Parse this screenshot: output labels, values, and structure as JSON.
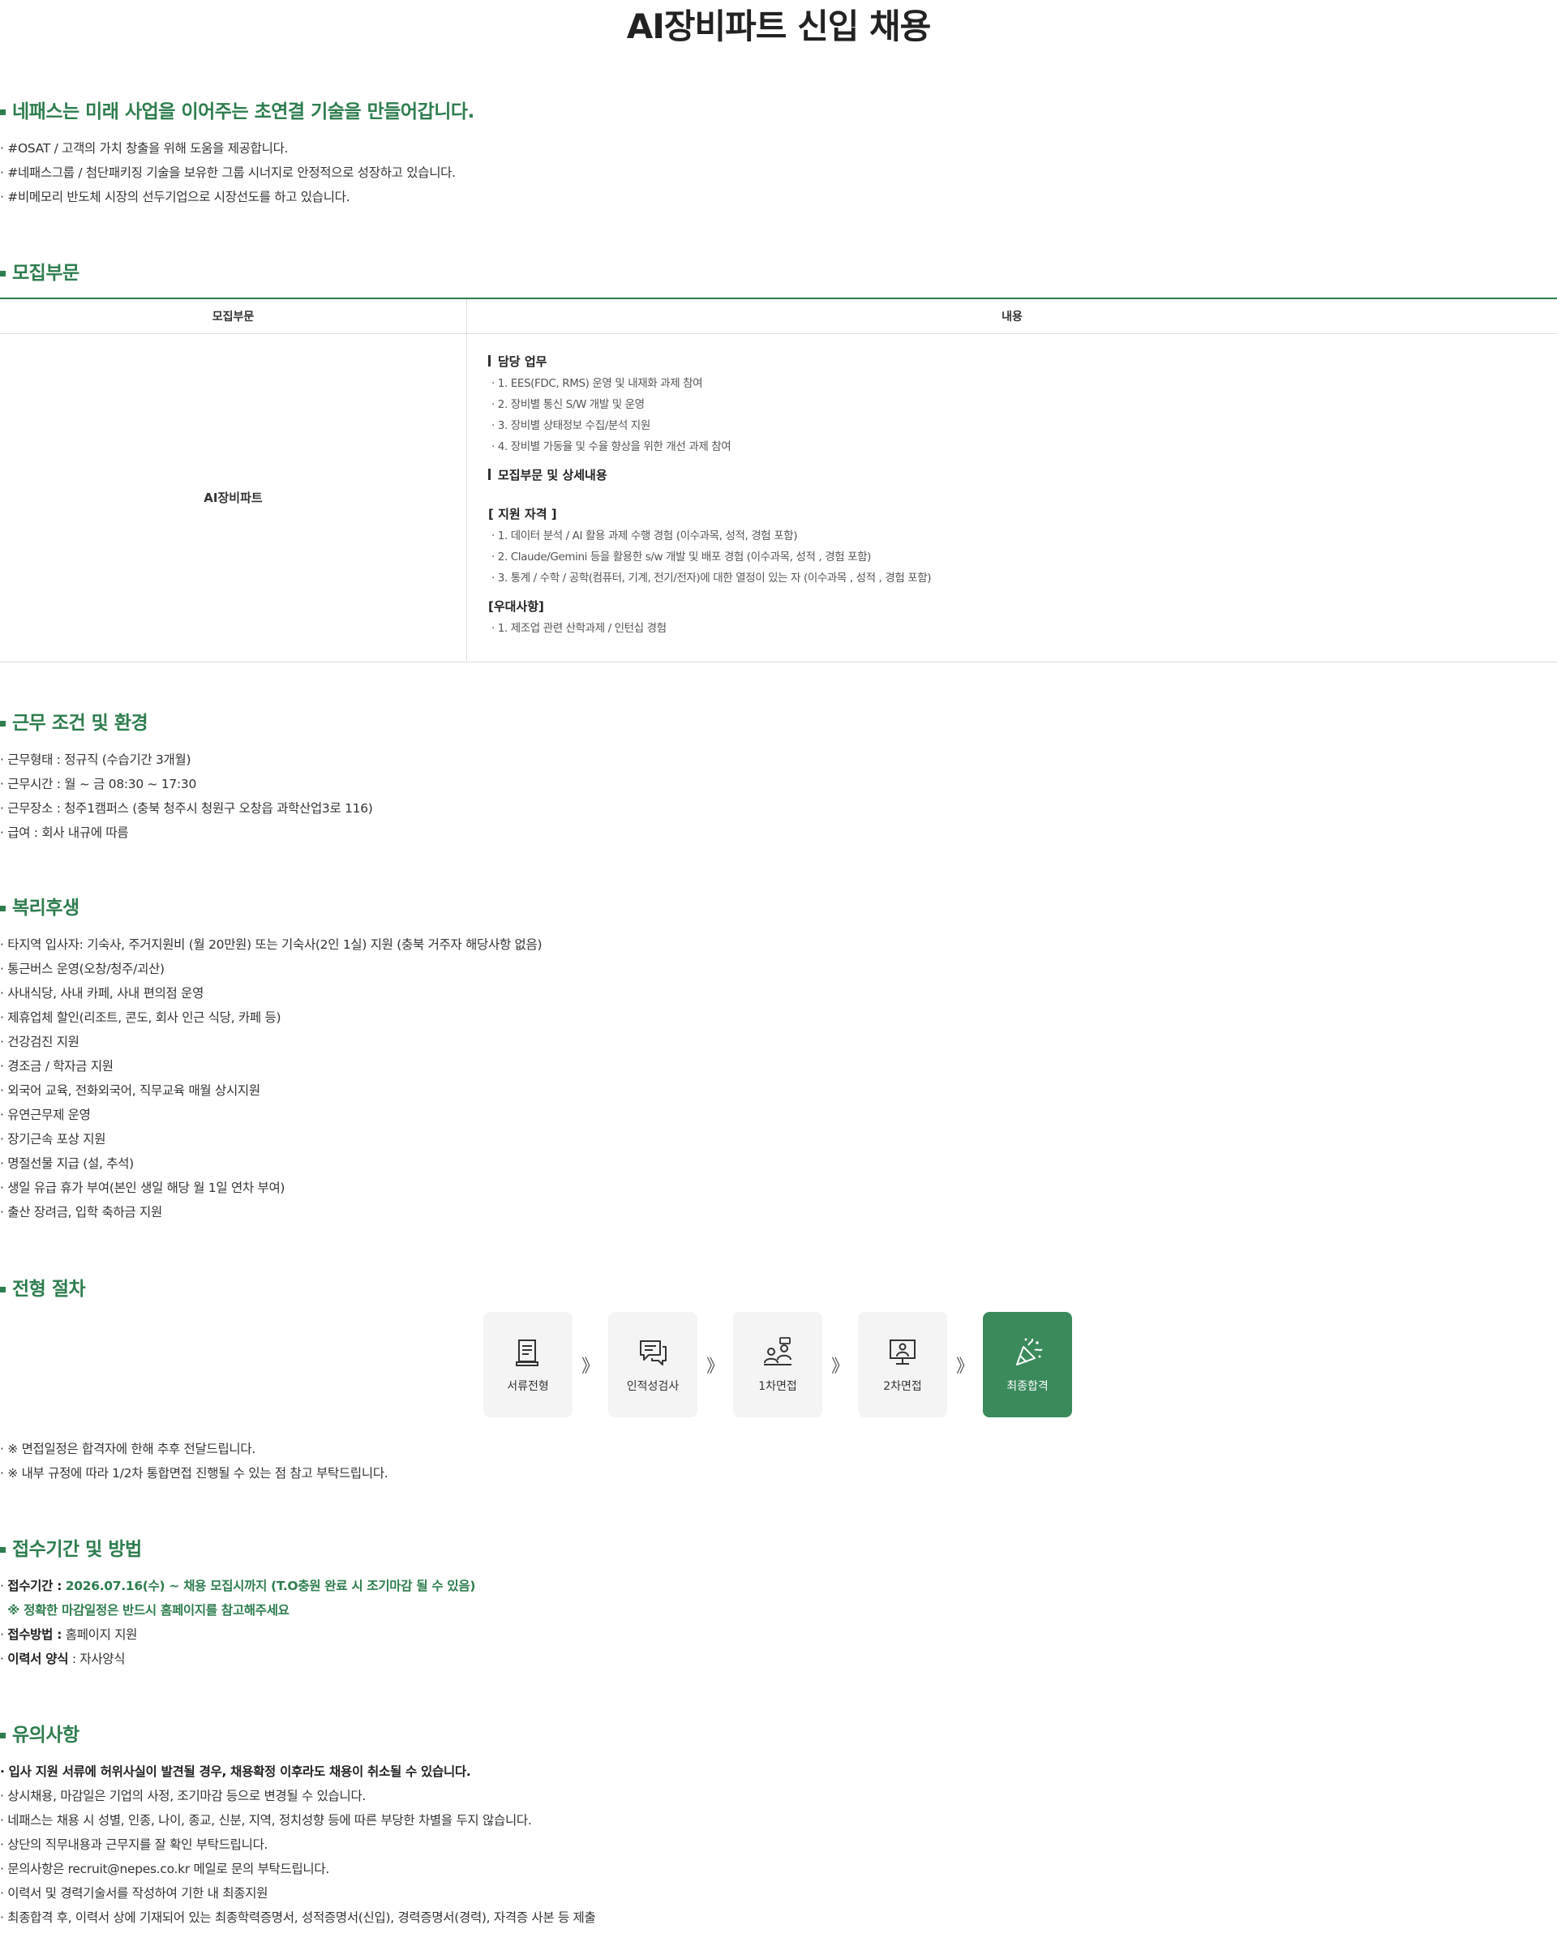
{
  "page_title": "AI장비파트 신입 채용",
  "intro": {
    "heading": "네패스는 미래 사업을 이어주는 초연결 기술을 만들어갑니다.",
    "items": [
      "· #OSAT / 고객의 가치 창출을 위해 도움을 제공합니다.",
      "· #네패스그룹 / 첨단패키징 기술을 보유한 그룹 시너지로 안정적으로 성장하고 있습니다.",
      "· #비메모리 반도체 시장의 선두기업으로 시장선도를 하고 있습니다."
    ]
  },
  "recruit": {
    "heading": "모집부문",
    "col_dept": "모집부문",
    "col_content": "내용",
    "dept": "AI장비파트",
    "duty_title": "담당 업무",
    "duties": [
      "· 1. EES(FDC, RMS) 운영 및 내재화 과제 참여",
      "· 2. 장비별 통신 S/W 개발 및 운영",
      "· 3. 장비별 상태정보 수집/분석 지원",
      "· 4. 장비별 가동율 및 수율 향상을 위한 개선 과제 참여"
    ],
    "detail_title": "모집부문 및 상세내용",
    "qual_title": "[ 지원 자격 ]",
    "quals": [
      "· 1. 데이터 분석 / AI 활용 과제 수행 경험 (이수과목, 성적, 경험 포함)",
      "· 2. Claude/Gemini 등을 활용한 s/w 개발 및 배포 경험 (이수과목, 성적 , 경험 포함)",
      "· 3. 통계 / 수학 / 공학(컴퓨터, 기계, 전기/전자)에 대한 열정이 있는 자 (이수과목 , 성적 , 경험 포함)"
    ],
    "pref_title": "[우대사항]",
    "prefs": [
      "· 1. 제조업 관련 산학과제 / 인턴십 경험"
    ]
  },
  "work": {
    "heading": "근무 조건 및 환경",
    "items": [
      "· 근무형태 : 정규직 (수습기간 3개월)",
      "· 근무시간 : 월 ~ 금 08:30 ~ 17:30",
      "· 근무장소 : 청주1캠퍼스 (충북 청주시 청원구 오창읍 과학산업3로 116)",
      "· 급여 : 회사 내규에 따름"
    ]
  },
  "welfare": {
    "heading": "복리후생",
    "items": [
      "· 타지역 입사자: 기숙사, 주거지원비 (월 20만원) 또는 기숙사(2인 1실) 지원 (충북 거주자 해당사항 없음)",
      "· 통근버스 운영(오창/청주/괴산)",
      "· 사내식당, 사내 카페, 사내 편의점 운영",
      "· 제휴업체 할인(리조트, 콘도, 회사 인근 식당, 카페 등)",
      "· 건강검진 지원",
      "· 경조금 / 학자금 지원",
      "· 외국어 교육, 전화외국어, 직무교육 매월 상시지원",
      "· 유연근무제 운영",
      "· 장기근속 포상 지원",
      "· 명절선물 지급 (설, 추석)",
      "· 생일 유급 휴가 부여(본인 생일 해당 월 1일 연차 부여)",
      "· 출산 장려금, 입학 축하금 지원"
    ]
  },
  "process": {
    "heading": "전형 절차",
    "arrow": "》",
    "steps": [
      {
        "label": "서류전형",
        "icon": "document-icon"
      },
      {
        "label": "인적성검사",
        "icon": "chat-icon"
      },
      {
        "label": "1차면접",
        "icon": "interview-icon"
      },
      {
        "label": "2차면접",
        "icon": "monitor-person-icon"
      },
      {
        "label": "최종합격",
        "icon": "celebration-icon"
      }
    ],
    "final_color": "#3a8a5c",
    "notes": [
      "· ※ 면접일정은 합격자에 한해 추후 전달드립니다.",
      "· ※ 내부 규정에 따라 1/2차 통합면접 진행될 수 있는 점 참고 부탁드립니다."
    ]
  },
  "apply": {
    "heading": "접수기간 및 방법",
    "period_label": "접수기간 :",
    "period_value": "2026.07.16(수) ~ 채용 모집시까지 (T.O충원 완료 시 조기마감 될 수 있음)",
    "period_note": "※ 정확한 마감일정은 반드시 홈페이지를 참고해주세요",
    "method_label": "접수방법 :",
    "method_value": "홈페이지 지원",
    "form_label": "이력서 양식",
    "form_value": ": 자사양식"
  },
  "notice": {
    "heading": "유의사항",
    "first": "· 입사 지원 서류에 허위사실이 발견될 경우, 채용확정 이후라도 채용이 취소될 수 있습니다.",
    "items": [
      "· 상시채용, 마감일은 기업의 사정, 조기마감 등으로 변경될 수 있습니다.",
      "· 네패스는 채용 시 성별, 인종, 나이, 종교, 신분, 지역, 정치성향 등에 따른 부당한 차별을 두지 않습니다.",
      "· 상단의 직무내용과 근무지를 잘 확인 부탁드립니다.",
      "· 문의사항은 recruit@nepes.co.kr 메일로 문의 부탁드립니다.",
      "· 이력서 및 경력기술서를 작성하여 기한 내 최종지원",
      "· 최종합격 후, 이력서 상에 기재되어 있는 최종학력증명서, 성적증명서(신입), 경력증명서(경력), 자격증 사본 등 제출"
    ]
  },
  "colors": {
    "accent": "#2e7d4f",
    "final_step": "#3a8a5c"
  }
}
